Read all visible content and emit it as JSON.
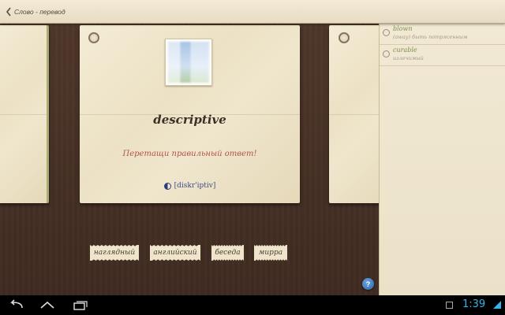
{
  "topbar": {
    "title": "Слово - перевод"
  },
  "card": {
    "word": "descriptive",
    "hint": "Перетащи правильный ответ!",
    "transcription": "[diskr'iptiv]"
  },
  "answers": [
    {
      "label": "наглядный"
    },
    {
      "label": "английский"
    },
    {
      "label": "беседа"
    },
    {
      "label": "мирра"
    }
  ],
  "help": {
    "label": "?"
  },
  "side_list": [
    {
      "word": "blown",
      "translation": "(away) быть потрясенным"
    },
    {
      "word": "curable",
      "translation": "излечимый"
    }
  ],
  "statusbar": {
    "time": "1:39"
  },
  "colors": {
    "hint": "#b2524a",
    "transcription": "#3f4d8a",
    "side_word": "#7d8f4a",
    "clock": "#38b2e8"
  },
  "icons": [
    "back-icon",
    "sound-icon",
    "pin-icon",
    "help-icon",
    "nav-back-icon",
    "nav-home-icon",
    "nav-recent-icon",
    "gallery-icon",
    "wifi-icon"
  ]
}
